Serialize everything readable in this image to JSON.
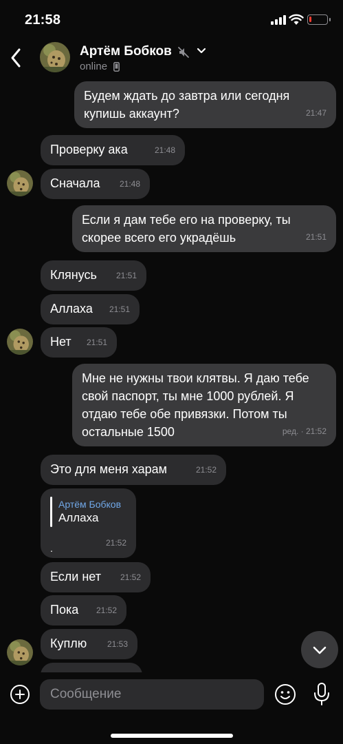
{
  "status_bar": {
    "time": "21:58",
    "battery_level": 0.1
  },
  "header": {
    "name": "Артём Бобков",
    "status": "online"
  },
  "messages": [
    {
      "text": "Будем ждать до завтра или сегодня купишь аккаунт?",
      "time": "21:47",
      "dir": "out"
    },
    {
      "text": "Проверку ака",
      "time": "21:48",
      "dir": "in"
    },
    {
      "text": "Сначала",
      "time": "21:48",
      "dir": "in"
    },
    {
      "text": "Если я дам тебе его на проверку, ты скорее всего его украдёшь",
      "time": "21:51",
      "dir": "out"
    },
    {
      "text": "Клянусь",
      "time": "21:51",
      "dir": "in"
    },
    {
      "text": "Аллаха",
      "time": "21:51",
      "dir": "in"
    },
    {
      "text": "Нет",
      "time": "21:51",
      "dir": "in"
    },
    {
      "text": "Мне не нужны твои клятвы. Я даю тебе свой паспорт, ты мне 1000 рублей. Я отдаю тебе обе привязки. Потом ты остальные 1500",
      "time": "ред. · 21:52",
      "dir": "out"
    },
    {
      "text": "Это для меня харам",
      "time": "21:52",
      "dir": "in"
    },
    {
      "text": ".",
      "time": "21:52",
      "dir": "in",
      "reply_name": "Артём Бобков",
      "reply_text": "Аллаха"
    },
    {
      "text": "Если нет",
      "time": "21:52",
      "dir": "in"
    },
    {
      "text": "Пока",
      "time": "21:52",
      "dir": "in"
    },
    {
      "text": "Куплю",
      "time": "21:53",
      "dir": "in"
    }
  ],
  "composer": {
    "placeholder": "Сообщение"
  }
}
